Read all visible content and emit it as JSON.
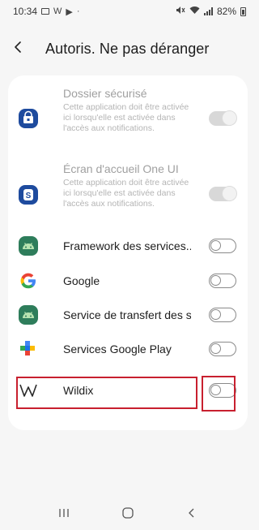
{
  "status_bar": {
    "time": "10:34",
    "battery_percent": "82%",
    "icons": [
      "gallery-notification-icon",
      "wildix-notification-icon",
      "play-notification-icon",
      "dot-icon",
      "mute-icon",
      "wifi-icon",
      "signal-icon",
      "battery-icon"
    ]
  },
  "header": {
    "title": "Autoris. Ne pas déranger",
    "back_icon": "chevron-left-icon"
  },
  "apps": [
    {
      "name": "Dossier sécurisé",
      "description": "Cette application doit être activée ici lorsqu'elle est activée dans l'accès aux notifications.",
      "icon": "secure-folder-icon",
      "icon_color": "#1e4b9e",
      "enabled": false,
      "toggle_state": "on-disabled"
    },
    {
      "name": "Écran d'accueil One UI",
      "description": "Cette application doit être activée ici lorsqu'elle est activée dans l'accès aux notifications.",
      "icon": "one-ui-home-icon",
      "icon_color": "#1e4b9e",
      "enabled": false,
      "toggle_state": "on-disabled"
    },
    {
      "name": "Framework des services..",
      "icon": "android-icon",
      "icon_color": "#2e7d5b",
      "enabled": true,
      "toggle_state": "off"
    },
    {
      "name": "Google",
      "icon": "google-icon",
      "icon_color": "#4285f4",
      "enabled": true,
      "toggle_state": "off"
    },
    {
      "name": "Service de transfert des s..",
      "icon": "android-icon",
      "icon_color": "#2e7d5b",
      "enabled": true,
      "toggle_state": "off"
    },
    {
      "name": "Services Google Play",
      "icon": "google-play-services-icon",
      "icon_color": "#34a853",
      "enabled": true,
      "toggle_state": "off"
    },
    {
      "name": "Wildix",
      "icon": "wildix-icon",
      "icon_color": "#2a2a2a",
      "enabled": true,
      "toggle_state": "off",
      "highlighted": true
    }
  ],
  "nav_bar": {
    "recents": "recents-icon",
    "home": "home-icon",
    "back": "back-icon"
  },
  "colors": {
    "highlight": "#c8202f",
    "background": "#f6f6f6",
    "card": "#ffffff"
  }
}
